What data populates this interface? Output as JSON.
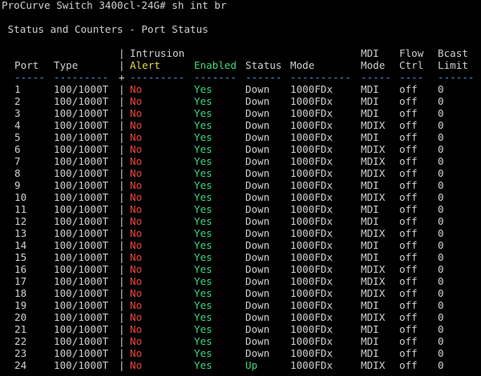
{
  "terminal": {
    "prompt_line": "ProCurve Switch 3400cl-24G# sh int br",
    "title": " Status and Counters - Port Status",
    "colors": {
      "background": "#000000",
      "text": "#cfcfcf",
      "alert_no": "#f0473f",
      "enabled_yes": "#3fd77a",
      "alert_header": "#e8d84e",
      "separator": "#5a8fd8"
    },
    "header": {
      "bar": "|",
      "plus": "+",
      "intrusion": "Intrusion",
      "mdi": "MDI",
      "flow": "Flow",
      "bcast": "Bcast",
      "port": "Port",
      "type": "Type",
      "alert": "Alert",
      "enabled": "Enabled",
      "status": "Status",
      "mode": "Mode",
      "mdi_mode": "Mode",
      "ctrl": "Ctrl",
      "limit": "Limit",
      "sep_port": "-----",
      "sep_type": "---------",
      "sep_alert": "---------",
      "sep_enabled": "-------",
      "sep_status": "------",
      "sep_mode": "----------",
      "sep_mdi": "-----",
      "sep_flow": "----",
      "sep_bcast": "------"
    },
    "rows": [
      {
        "port": "1",
        "type": "100/1000T",
        "alert": "No",
        "enabled": "Yes",
        "status": "Down",
        "mode": "1000FDx",
        "mdi": "MDI",
        "flow": "off",
        "bcast": "0"
      },
      {
        "port": "2",
        "type": "100/1000T",
        "alert": "No",
        "enabled": "Yes",
        "status": "Down",
        "mode": "1000FDx",
        "mdi": "MDI",
        "flow": "off",
        "bcast": "0"
      },
      {
        "port": "3",
        "type": "100/1000T",
        "alert": "No",
        "enabled": "Yes",
        "status": "Down",
        "mode": "1000FDx",
        "mdi": "MDI",
        "flow": "off",
        "bcast": "0"
      },
      {
        "port": "4",
        "type": "100/1000T",
        "alert": "No",
        "enabled": "Yes",
        "status": "Down",
        "mode": "1000FDx",
        "mdi": "MDIX",
        "flow": "off",
        "bcast": "0"
      },
      {
        "port": "5",
        "type": "100/1000T",
        "alert": "No",
        "enabled": "Yes",
        "status": "Down",
        "mode": "1000FDx",
        "mdi": "MDI",
        "flow": "off",
        "bcast": "0"
      },
      {
        "port": "6",
        "type": "100/1000T",
        "alert": "No",
        "enabled": "Yes",
        "status": "Down",
        "mode": "1000FDx",
        "mdi": "MDIX",
        "flow": "off",
        "bcast": "0"
      },
      {
        "port": "7",
        "type": "100/1000T",
        "alert": "No",
        "enabled": "Yes",
        "status": "Down",
        "mode": "1000FDx",
        "mdi": "MDIX",
        "flow": "off",
        "bcast": "0"
      },
      {
        "port": "8",
        "type": "100/1000T",
        "alert": "No",
        "enabled": "Yes",
        "status": "Down",
        "mode": "1000FDx",
        "mdi": "MDIX",
        "flow": "off",
        "bcast": "0"
      },
      {
        "port": "9",
        "type": "100/1000T",
        "alert": "No",
        "enabled": "Yes",
        "status": "Down",
        "mode": "1000FDx",
        "mdi": "MDI",
        "flow": "off",
        "bcast": "0"
      },
      {
        "port": "10",
        "type": "100/1000T",
        "alert": "No",
        "enabled": "Yes",
        "status": "Down",
        "mode": "1000FDx",
        "mdi": "MDIX",
        "flow": "off",
        "bcast": "0"
      },
      {
        "port": "11",
        "type": "100/1000T",
        "alert": "No",
        "enabled": "Yes",
        "status": "Down",
        "mode": "1000FDx",
        "mdi": "MDI",
        "flow": "off",
        "bcast": "0"
      },
      {
        "port": "12",
        "type": "100/1000T",
        "alert": "No",
        "enabled": "Yes",
        "status": "Down",
        "mode": "1000FDx",
        "mdi": "MDI",
        "flow": "off",
        "bcast": "0"
      },
      {
        "port": "13",
        "type": "100/1000T",
        "alert": "No",
        "enabled": "Yes",
        "status": "Down",
        "mode": "1000FDx",
        "mdi": "MDIX",
        "flow": "off",
        "bcast": "0"
      },
      {
        "port": "14",
        "type": "100/1000T",
        "alert": "No",
        "enabled": "Yes",
        "status": "Down",
        "mode": "1000FDx",
        "mdi": "MDI",
        "flow": "off",
        "bcast": "0"
      },
      {
        "port": "15",
        "type": "100/1000T",
        "alert": "No",
        "enabled": "Yes",
        "status": "Down",
        "mode": "1000FDx",
        "mdi": "MDI",
        "flow": "off",
        "bcast": "0"
      },
      {
        "port": "16",
        "type": "100/1000T",
        "alert": "No",
        "enabled": "Yes",
        "status": "Down",
        "mode": "1000FDx",
        "mdi": "MDIX",
        "flow": "off",
        "bcast": "0"
      },
      {
        "port": "17",
        "type": "100/1000T",
        "alert": "No",
        "enabled": "Yes",
        "status": "Down",
        "mode": "1000FDx",
        "mdi": "MDIX",
        "flow": "off",
        "bcast": "0"
      },
      {
        "port": "18",
        "type": "100/1000T",
        "alert": "No",
        "enabled": "Yes",
        "status": "Down",
        "mode": "1000FDx",
        "mdi": "MDIX",
        "flow": "off",
        "bcast": "0"
      },
      {
        "port": "19",
        "type": "100/1000T",
        "alert": "No",
        "enabled": "Yes",
        "status": "Down",
        "mode": "1000FDx",
        "mdi": "MDI",
        "flow": "off",
        "bcast": "0"
      },
      {
        "port": "20",
        "type": "100/1000T",
        "alert": "No",
        "enabled": "Yes",
        "status": "Down",
        "mode": "1000FDx",
        "mdi": "MDIX",
        "flow": "off",
        "bcast": "0"
      },
      {
        "port": "21",
        "type": "100/1000T",
        "alert": "No",
        "enabled": "Yes",
        "status": "Down",
        "mode": "1000FDx",
        "mdi": "MDI",
        "flow": "off",
        "bcast": "0"
      },
      {
        "port": "22",
        "type": "100/1000T",
        "alert": "No",
        "enabled": "Yes",
        "status": "Down",
        "mode": "1000FDx",
        "mdi": "MDI",
        "flow": "off",
        "bcast": "0"
      },
      {
        "port": "23",
        "type": "100/1000T",
        "alert": "No",
        "enabled": "Yes",
        "status": "Down",
        "mode": "1000FDx",
        "mdi": "MDI",
        "flow": "off",
        "bcast": "0"
      },
      {
        "port": "24",
        "type": "100/1000T",
        "alert": "No",
        "enabled": "Yes",
        "status": "Up",
        "mode": "1000FDx",
        "mdi": "MDIX",
        "flow": "off",
        "bcast": "0"
      }
    ]
  }
}
